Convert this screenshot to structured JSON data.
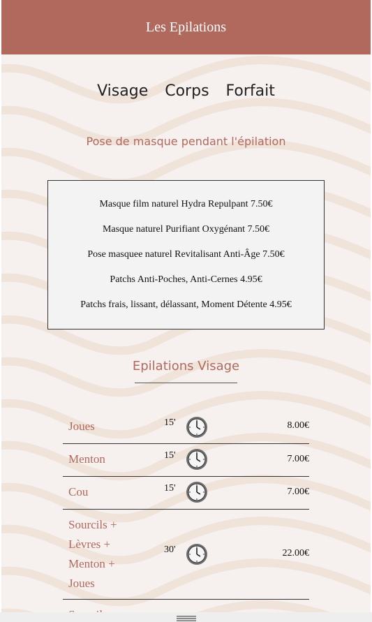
{
  "header": {
    "title": "Les Epilations"
  },
  "nav": {
    "tabs": [
      "Visage",
      "Corps",
      "Forfait"
    ]
  },
  "subtitle": "Pose de masque pendant l'épilation",
  "masks": [
    "Masque film naturel Hydra Repulpant 7.50€",
    "Masque naturel Purifiant Oxygénant 7.50€",
    "Pose masquee naturel Revitalisant Anti-Âge 7.50€",
    "Patchs Anti-Poches, Anti-Cernes 4.95€",
    "Patchs frais, lissant, délassant, Moment Détente 4.95€"
  ],
  "section": {
    "title": "Epilations Visage"
  },
  "services": [
    {
      "name": [
        "Joues"
      ],
      "duration": "15'",
      "price": "8.00€"
    },
    {
      "name": [
        "Menton"
      ],
      "duration": "15'",
      "price": "7.00€"
    },
    {
      "name": [
        "Cou"
      ],
      "duration": "15'",
      "price": "7.00€"
    },
    {
      "name": [
        "Sourcils +",
        "Lèvres +",
        "Menton +",
        "Joues"
      ],
      "duration": "30'",
      "price": "22.00€"
    },
    {
      "name": [
        "Sourcil"
      ],
      "duration": "",
      "price": ""
    }
  ],
  "icons": {
    "clock": "clock-icon",
    "handle": "menu-handle-icon"
  },
  "colors": {
    "accent": "#b0695c",
    "background": "#f6f1ee",
    "header_text": "#ffffff"
  }
}
